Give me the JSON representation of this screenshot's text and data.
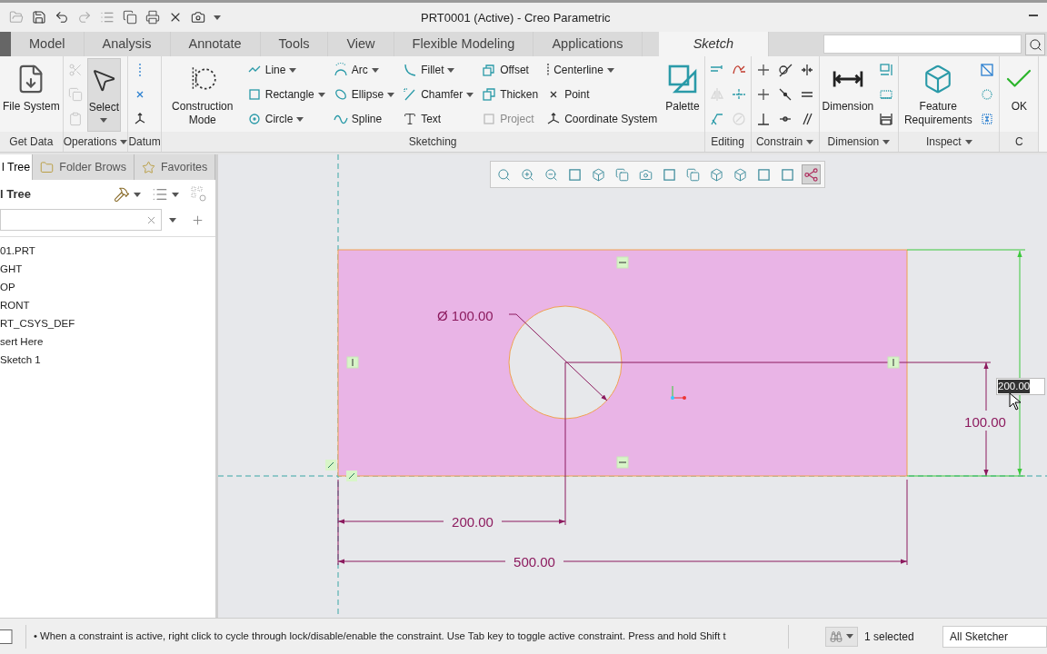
{
  "window": {
    "title": "PRT0001 (Active) - Creo Parametric"
  },
  "ribbon_tabs": [
    {
      "label": "Model",
      "selected": false
    },
    {
      "label": "Analysis",
      "selected": false
    },
    {
      "label": "Annotate",
      "selected": false
    },
    {
      "label": "Tools",
      "selected": false
    },
    {
      "label": "View",
      "selected": false
    },
    {
      "label": "Flexible Modeling",
      "selected": false
    },
    {
      "label": "Applications",
      "selected": false
    },
    {
      "label": "Sketch",
      "selected": true
    }
  ],
  "ribbon_groups": [
    {
      "label": "Get Data",
      "menu": false,
      "items": [
        {
          "kind": "large",
          "label": "File System",
          "menu": false,
          "disabled": false
        }
      ]
    },
    {
      "label": "Operations",
      "menu": true,
      "items": [
        {
          "kind": "icon",
          "menu": false,
          "disabled": true
        },
        {
          "kind": "icon",
          "menu": false,
          "disabled": true
        },
        {
          "kind": "icon",
          "menu": false,
          "disabled": true
        },
        {
          "kind": "large",
          "label": "Select",
          "menu": true,
          "disabled": false
        }
      ]
    },
    {
      "label": "Datum",
      "menu": false,
      "items": [
        {
          "kind": "icon",
          "menu": false,
          "disabled": false
        },
        {
          "kind": "icon",
          "menu": false,
          "disabled": false
        },
        {
          "kind": "icon",
          "menu": false,
          "disabled": false
        }
      ]
    },
    {
      "label": "Sketching",
      "menu": false,
      "items": [
        {
          "kind": "large",
          "label": "Construction Mode",
          "menu": false,
          "disabled": false
        },
        {
          "kind": "small",
          "label": "Line",
          "menu": true,
          "disabled": false
        },
        {
          "kind": "small",
          "label": "Rectangle",
          "menu": true,
          "disabled": false
        },
        {
          "kind": "small",
          "label": "Circle",
          "menu": true,
          "disabled": false
        },
        {
          "kind": "small",
          "label": "Arc",
          "menu": true,
          "disabled": false
        },
        {
          "kind": "small",
          "label": "Ellipse",
          "menu": true,
          "disabled": false
        },
        {
          "kind": "small",
          "label": "Spline",
          "menu": false,
          "disabled": false
        },
        {
          "kind": "small",
          "label": "Fillet",
          "menu": true,
          "disabled": false
        },
        {
          "kind": "small",
          "label": "Chamfer",
          "menu": true,
          "disabled": false
        },
        {
          "kind": "small",
          "label": "Text",
          "menu": false,
          "disabled": false
        },
        {
          "kind": "small",
          "label": "Offset",
          "menu": false,
          "disabled": false
        },
        {
          "kind": "small",
          "label": "Thicken",
          "menu": false,
          "disabled": false
        },
        {
          "kind": "small",
          "label": "Project",
          "menu": false,
          "disabled": true
        },
        {
          "kind": "small",
          "label": "Centerline",
          "menu": true,
          "disabled": false
        },
        {
          "kind": "small",
          "label": "Point",
          "menu": false,
          "disabled": false
        },
        {
          "kind": "small",
          "label": "Coordinate System",
          "menu": false,
          "disabled": false
        },
        {
          "kind": "large",
          "label": "Palette",
          "menu": false,
          "disabled": false
        }
      ]
    },
    {
      "label": "Editing",
      "menu": false,
      "items": [
        {
          "kind": "icon",
          "menu": false,
          "disabled": false
        },
        {
          "kind": "icon",
          "menu": false,
          "disabled": true
        },
        {
          "kind": "icon",
          "menu": false,
          "disabled": false
        },
        {
          "kind": "icon",
          "menu": false,
          "disabled": false
        },
        {
          "kind": "icon",
          "menu": false,
          "disabled": false
        },
        {
          "kind": "icon",
          "menu": false,
          "disabled": true
        }
      ]
    },
    {
      "label": "Constrain",
      "menu": true,
      "items": [
        {
          "kind": "icon",
          "menu": false,
          "disabled": false
        },
        {
          "kind": "icon",
          "menu": false,
          "disabled": false
        },
        {
          "kind": "icon",
          "menu": false,
          "disabled": false
        },
        {
          "kind": "icon",
          "menu": false,
          "disabled": false
        },
        {
          "kind": "icon",
          "menu": false,
          "disabled": false
        },
        {
          "kind": "icon",
          "menu": false,
          "disabled": false
        },
        {
          "kind": "icon",
          "menu": false,
          "disabled": false
        },
        {
          "kind": "icon",
          "menu": false,
          "disabled": false
        },
        {
          "kind": "icon",
          "menu": false,
          "disabled": false
        }
      ]
    },
    {
      "label": "Dimension",
      "menu": true,
      "items": [
        {
          "kind": "large",
          "label": "Dimension",
          "menu": false,
          "disabled": false
        },
        {
          "kind": "icon",
          "menu": false,
          "disabled": false
        },
        {
          "kind": "icon",
          "menu": false,
          "disabled": false
        },
        {
          "kind": "icon",
          "menu": false,
          "disabled": false
        }
      ]
    },
    {
      "label": "Inspect",
      "menu": true,
      "items": [
        {
          "kind": "large",
          "label": "Feature Requirements",
          "menu": false,
          "disabled": false
        },
        {
          "kind": "icon",
          "menu": false,
          "disabled": false
        },
        {
          "kind": "icon",
          "menu": false,
          "disabled": false
        },
        {
          "kind": "icon",
          "menu": false,
          "disabled": false
        }
      ]
    },
    {
      "label": "C",
      "menu": false,
      "items": [
        {
          "kind": "large",
          "label": "OK",
          "menu": false,
          "disabled": false
        }
      ]
    }
  ],
  "left_panel": {
    "tabs": [
      {
        "label": "l Tree",
        "selected": true
      },
      {
        "label": "Folder Brows",
        "selected": false
      },
      {
        "label": "Favorites",
        "selected": false
      }
    ],
    "header": "l Tree",
    "tree_items": [
      "01.PRT",
      "GHT",
      "OP",
      "RONT",
      "RT_CSYS_DEF",
      "sert Here",
      "Sketch 1"
    ]
  },
  "view_toolbar": [
    {
      "selected": false
    },
    {
      "selected": false
    },
    {
      "selected": false
    },
    {
      "selected": false
    },
    {
      "selected": false
    },
    {
      "selected": false
    },
    {
      "selected": false
    },
    {
      "selected": false
    },
    {
      "selected": false
    },
    {
      "selected": false
    },
    {
      "selected": false
    },
    {
      "selected": false
    },
    {
      "selected": false
    },
    {
      "selected": true
    }
  ],
  "sketch": {
    "diameter_dimension": "Ø 100.00",
    "horizontal_dimension": "200.00",
    "width_dimension": "500.00",
    "vertical_dimension": "100.00",
    "edit_value": "200.00"
  },
  "status_bar": {
    "message": "• When a constraint is active, right click to cycle through lock/disable/enable the constraint. Use Tab key to toggle active constraint. Press and hold Shift t",
    "selection": "1 selected",
    "filter": "All Sketcher"
  }
}
